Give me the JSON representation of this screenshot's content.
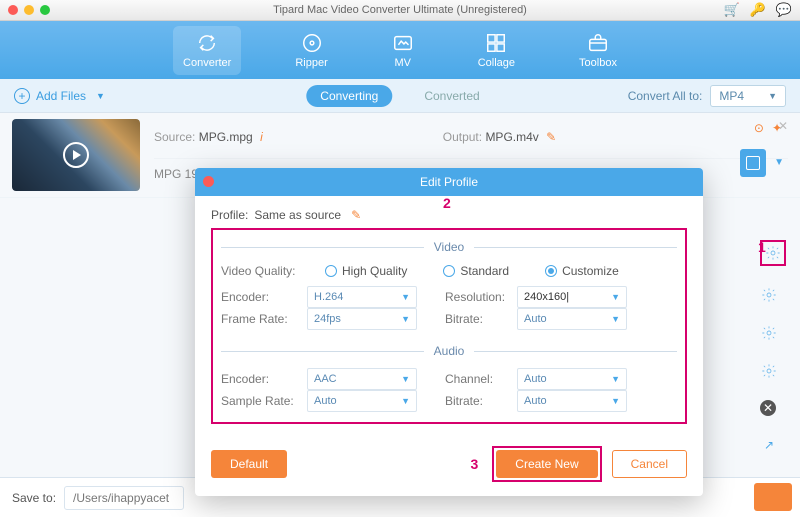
{
  "window_title": "Tipard Mac Video Converter Ultimate (Unregistered)",
  "nav": {
    "converter": "Converter",
    "ripper": "Ripper",
    "mv": "MV",
    "collage": "Collage",
    "toolbox": "Toolbox"
  },
  "subbar": {
    "add_files": "Add Files",
    "tab_converting": "Converting",
    "tab_converted": "Converted",
    "convert_all_label": "Convert All to:",
    "convert_all_value": "MP4"
  },
  "item": {
    "source_label": "Source:",
    "source_value": "MPG.mpg",
    "output_label": "Output:",
    "output_value": "MPG.m4v",
    "line2": "MPG  19"
  },
  "callouts": {
    "one": "1",
    "two": "2",
    "three": "3"
  },
  "modal": {
    "title": "Edit Profile",
    "profile_label": "Profile:",
    "profile_value": "Same as source",
    "section_video": "Video",
    "section_audio": "Audio",
    "video_quality_label": "Video Quality:",
    "q_high": "High Quality",
    "q_standard": "Standard",
    "q_custom": "Customize",
    "encoder_label": "Encoder:",
    "resolution_label": "Resolution:",
    "frame_rate_label": "Frame Rate:",
    "bitrate_label": "Bitrate:",
    "sample_rate_label": "Sample Rate:",
    "channel_label": "Channel:",
    "v_encoder": "H.264",
    "v_resolution": "240x160|",
    "v_frame": "24fps",
    "v_bitrate": "Auto",
    "a_encoder": "AAC",
    "a_sample": "Auto",
    "a_channel": "Auto",
    "a_bitrate": "Auto",
    "btn_default": "Default",
    "btn_create": "Create New",
    "btn_cancel": "Cancel"
  },
  "save": {
    "label": "Save to:",
    "path": "/Users/ihappyacet"
  }
}
